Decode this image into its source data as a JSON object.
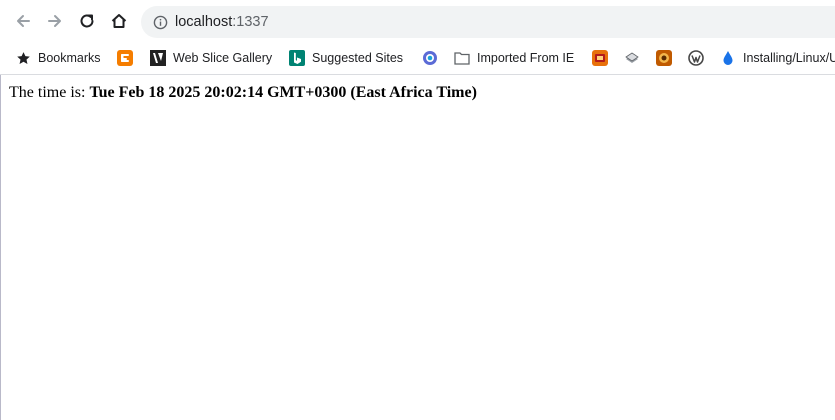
{
  "browser": {
    "address_bar": {
      "host": "localhost",
      "port": ":1337"
    },
    "bookmarks": [
      {
        "label": "Bookmarks",
        "icon": "star-icon"
      },
      {
        "label": "",
        "icon": "blogger-icon"
      },
      {
        "label": "Web Slice Gallery",
        "icon": "web-slice-icon"
      },
      {
        "label": "Suggested Sites",
        "icon": "bing-icon"
      },
      {
        "label": "",
        "icon": "app-icon"
      },
      {
        "label": "Imported From IE",
        "icon": "folder-icon"
      },
      {
        "label": "",
        "icon": "orange-app-icon"
      },
      {
        "label": "",
        "icon": "stack-icon"
      },
      {
        "label": "",
        "icon": "speaker-icon"
      },
      {
        "label": "",
        "icon": "wordpress-icon"
      },
      {
        "label": "Installing/Linux/U",
        "icon": "drop-icon"
      }
    ]
  },
  "page": {
    "prefix": "The time is: ",
    "time": "Tue Feb 18 2025 20:02:14 GMT+0300 (East Africa Time)"
  },
  "colors": {
    "omnibox_bg": "#f1f3f4",
    "blogger": "#f57d00",
    "bing": "#008373",
    "wordpress": "#464646",
    "drop": "#1a73e8"
  }
}
